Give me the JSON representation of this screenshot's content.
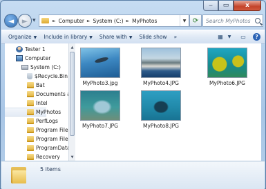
{
  "window": {
    "caption_buttons": {
      "minimize": "‒",
      "maximize": "▭",
      "close": "x"
    }
  },
  "navigation": {
    "back_glyph": "◄",
    "forward_glyph": "►",
    "breadcrumbs": [
      "Computer",
      "System (C:)",
      "MyPhotos"
    ],
    "search_placeholder": "Search MyPhotos"
  },
  "toolbar": {
    "organize": "Organize",
    "include_in_library": "Include in library",
    "share_with": "Share with",
    "slide_show": "Slide show",
    "more": "»"
  },
  "tree": {
    "items": [
      {
        "label": "Tester 1",
        "icon": "user-icon"
      },
      {
        "label": "Computer",
        "icon": "computer-icon"
      },
      {
        "label": "System (C:)",
        "icon": "drive-icon"
      },
      {
        "label": "$Recycle.Bin",
        "icon": "recycle-bin-icon"
      },
      {
        "label": "Bat",
        "icon": "folder-icon"
      },
      {
        "label": "Documents a",
        "icon": "folder-icon"
      },
      {
        "label": "Intel",
        "icon": "folder-icon"
      },
      {
        "label": "MyPhotos",
        "icon": "folder-icon",
        "selected": true
      },
      {
        "label": "PerfLogs",
        "icon": "folder-icon"
      },
      {
        "label": "Program Files",
        "icon": "folder-icon"
      },
      {
        "label": "Program Files",
        "icon": "folder-icon"
      },
      {
        "label": "ProgramData",
        "icon": "folder-icon"
      },
      {
        "label": "Recovery",
        "icon": "folder-icon"
      }
    ]
  },
  "files": [
    {
      "name": "MyPhoto3.jpg"
    },
    {
      "name": "MyPhoto4.JPG"
    },
    {
      "name": "MyPhoto6.JPG"
    },
    {
      "name": "MyPhoto7.JPG"
    },
    {
      "name": "MyPhoto8.JPG"
    }
  ],
  "details": {
    "item_count": "5 items"
  }
}
